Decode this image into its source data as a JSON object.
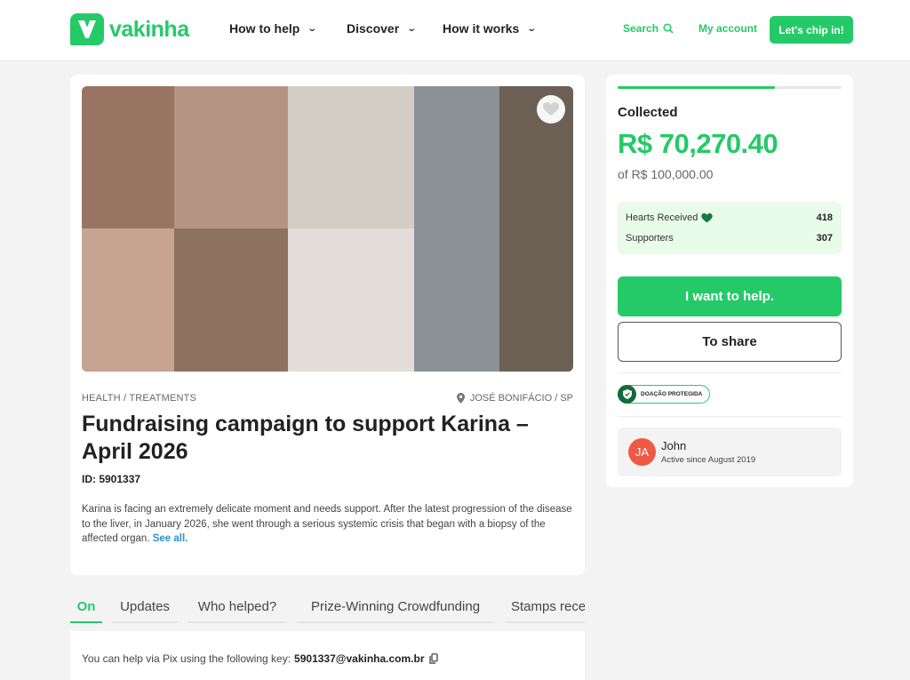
{
  "header": {
    "logo_text": "vakinha",
    "nav": [
      "How to help",
      "Discover",
      "How it works"
    ],
    "search_label": "Search",
    "account_label": "My account",
    "cta_label": "Let's chip in!"
  },
  "campaign": {
    "category": "HEALTH / TREATMENTS",
    "location": "JOSÉ BONIFÁCIO / SP",
    "title": "Fundraising campaign to support Karina – April 2026",
    "id_label": "ID: 5901337",
    "description": "Karina is facing an extremely delicate moment and needs support. After the latest progression of the disease to the liver, in January 2026, she went through a serious systemic crisis that began with a biopsy of the affected organ.",
    "see_all": "See all."
  },
  "tabs": [
    {
      "label": "On",
      "active": true
    },
    {
      "label": "Updates",
      "active": false
    },
    {
      "label": "Who helped?",
      "active": false
    },
    {
      "label": "Prize-Winning Crowdfunding",
      "active": false
    },
    {
      "label": "Stamps received",
      "active": false
    }
  ],
  "pix": {
    "text": "You can help via Pix using the following key:",
    "key": "5901337@vakinha.com.br"
  },
  "donation": {
    "progress_fraction": 0.7027,
    "collected_label": "Collected",
    "collected_amount": "R$ 70,270.40",
    "goal": "of R$ 100,000.00",
    "hearts_label": "Hearts Received",
    "hearts_value": "418",
    "supporters_label": "Supporters",
    "supporters_value": "307",
    "help_button": "I want to help.",
    "share_button": "To share",
    "protected_badge": "DOAÇÃO PROTEGIDA"
  },
  "organizer": {
    "initials": "JA",
    "name": "John",
    "since": "Active since August 2019"
  },
  "colors": {
    "brand_green": "#24ca68",
    "stats_background": "#e9fbe9",
    "avatar": "#ef5a45",
    "link_blue": "#2d8fd8"
  },
  "icons": [
    "logo-icon",
    "chevron-down-icon",
    "search-icon",
    "heart-icon",
    "location-pin-icon",
    "copy-icon",
    "shield-icon"
  ]
}
